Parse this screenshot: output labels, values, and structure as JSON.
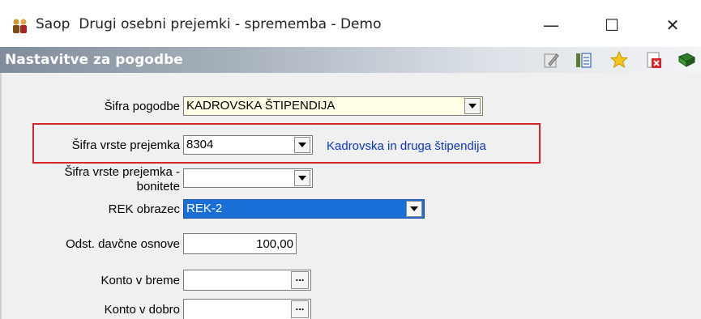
{
  "window": {
    "app_name": "Saop",
    "title": "Drugi osebni prejemki  - sprememba - Demo",
    "controls": {
      "minimize": "—",
      "maximize": "☐",
      "close": "✕"
    }
  },
  "header": {
    "title": "Nastavitve za pogodbe",
    "toolbar_icons": [
      "edit-icon",
      "columns-icon",
      "star-icon",
      "delete-icon",
      "book-icon"
    ]
  },
  "form": {
    "sifra_pogodbe": {
      "label": "Šifra pogodbe",
      "value": "KADROVSKA ŠTIPENDIJA"
    },
    "sifra_vrste_prejemka": {
      "label": "Šifra vrste prejemka",
      "value": "8304",
      "description": "Kadrovska in druga štipendija"
    },
    "sifra_vrste_prejemka_bonitete": {
      "label_line1": "Šifra vrste prejemka -",
      "label_line2": "bonitete",
      "value": ""
    },
    "rek_obrazec": {
      "label": "REK obrazec",
      "value": "REK-2"
    },
    "odst_davcne_osnove": {
      "label": "Odst. davčne osnove",
      "value": "100,00"
    },
    "konto_v_breme": {
      "label": "Konto v breme",
      "value": "",
      "button": "..."
    },
    "konto_v_dobro": {
      "label": "Konto v dobro",
      "value": "",
      "button": "..."
    }
  },
  "colors": {
    "highlight": "#d9232b",
    "description": "#0a36c8",
    "selected": "#1a6fd6"
  }
}
